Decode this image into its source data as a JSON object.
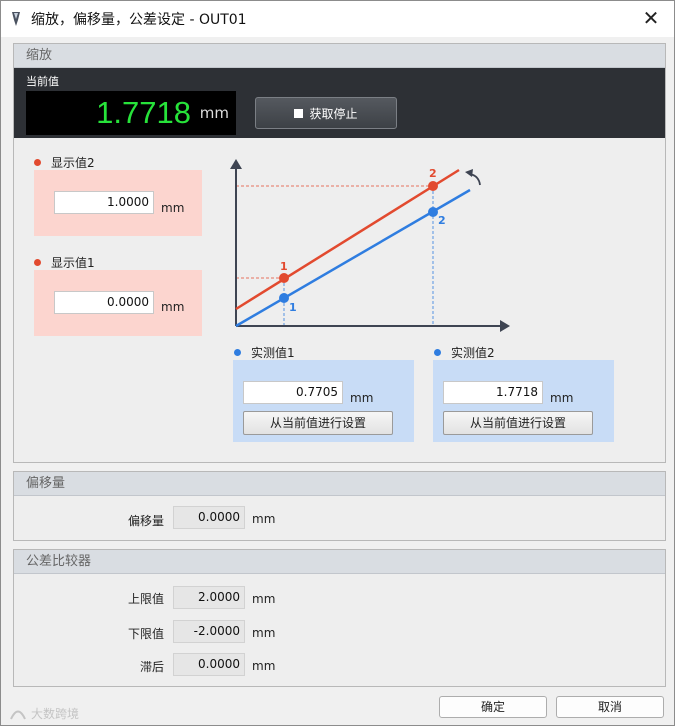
{
  "window": {
    "title": "缩放，偏移量，公差设定 - OUT01",
    "close_symbol": "✕"
  },
  "scaling": {
    "header": "缩放",
    "current_value_label": "当前值",
    "current_value": "1.7718",
    "current_unit": "mm",
    "stop_button_label": "获取停止",
    "display2": {
      "label": "显示值2",
      "value": "1.0000",
      "unit": "mm"
    },
    "display1": {
      "label": "显示值1",
      "value": "0.0000",
      "unit": "mm"
    },
    "measured1": {
      "label": "实测值1",
      "value": "0.7705",
      "unit": "mm",
      "button": "从当前值进行设置"
    },
    "measured2": {
      "label": "实测值2",
      "value": "1.7718",
      "unit": "mm",
      "button": "从当前值进行设置"
    },
    "diagram": {
      "point1": "1",
      "point2": "2",
      "colors": {
        "display_line": "#e24a2f",
        "measured_line": "#2f7de0",
        "axis": "#3e4452"
      }
    }
  },
  "offset": {
    "header": "偏移量",
    "label": "偏移量",
    "value": "0.0000",
    "unit": "mm"
  },
  "tolerance": {
    "header": "公差比较器",
    "upper": {
      "label": "上限值",
      "value": "2.0000",
      "unit": "mm"
    },
    "lower": {
      "label": "下限值",
      "value": "-2.0000",
      "unit": "mm"
    },
    "hysteresis": {
      "label": "滞后",
      "value": "0.0000",
      "unit": "mm"
    }
  },
  "footer": {
    "ok": "确定",
    "cancel": "取消",
    "watermark": "大数跨境"
  },
  "colors": {
    "readout_text": "#27e33a",
    "dark_panel": "#2d3035",
    "pink_bg": "#fcd5cf",
    "blue_bg": "#c8dcf6"
  }
}
